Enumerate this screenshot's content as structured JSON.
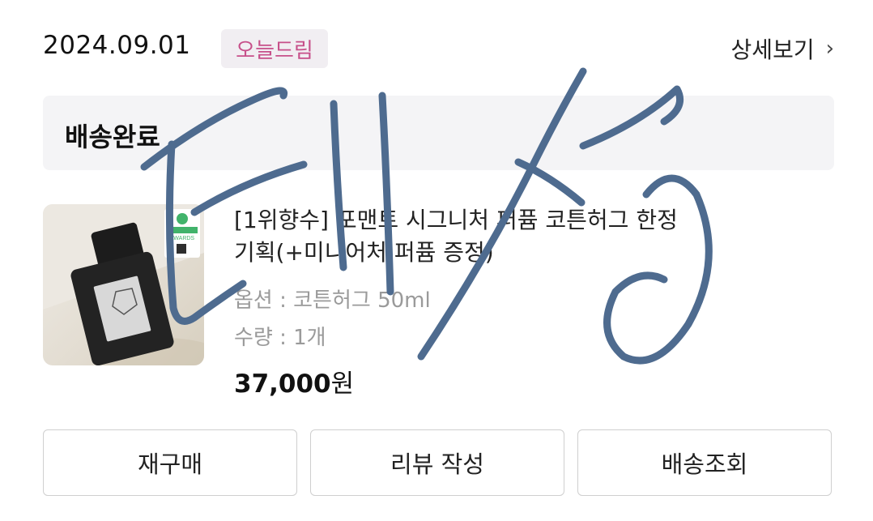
{
  "order": {
    "date": "2024.09.01",
    "brand_badge": "오늘드림",
    "detail_link": "상세보기",
    "detail_chevron": "›",
    "status": "배송완료"
  },
  "product": {
    "name_line1": "[1위향수] 포맨트 시그니처 퍼퓸 코튼허그 한정",
    "name_line2": "기획(+미니어처 퍼퓸 증정)",
    "option": "옵션 : 코튼허그 50ml",
    "quantity": "수량 : 1개",
    "price_number": "37,000",
    "price_unit": "원",
    "image_icon": "perfume-bottle-photo",
    "award_badge_text": "AWARDS"
  },
  "actions": {
    "rebuy": "재구매",
    "review": "리뷰 작성",
    "track": "배송조회"
  },
  "handwriting": {
    "text": "테성",
    "ink_color": "#4e6b8f"
  }
}
